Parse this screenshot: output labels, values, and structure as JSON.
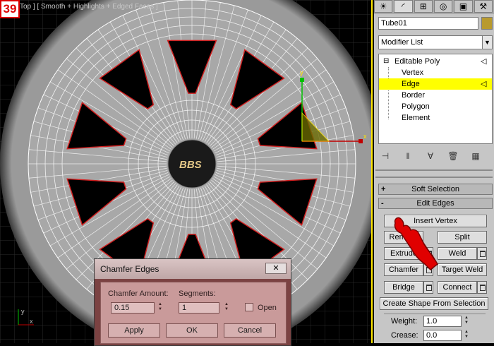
{
  "step_badge": "39",
  "viewport": {
    "label": "Top ] [ Smooth + Highlights + Edged Faces ]",
    "logo_text": "BBS",
    "gizmo_y_label": "y",
    "gizmo_x_label": "x",
    "axis_y_label": "y",
    "axis_x_label": "x"
  },
  "panel": {
    "tabs": [
      "sun-icon",
      "arc-icon",
      "hierarchy-icon",
      "motion-icon",
      "display-icon",
      "utilities-icon"
    ],
    "object_name": "Tube01",
    "object_color": "#b89a2e",
    "modifier_list": "Modifier List",
    "stack": [
      {
        "label": "Editable Poly",
        "level": 0,
        "expander": "⊟"
      },
      {
        "label": "Vertex",
        "level": 1
      },
      {
        "label": "Edge",
        "level": 1,
        "selected": true
      },
      {
        "label": "Border",
        "level": 1
      },
      {
        "label": "Polygon",
        "level": 1
      },
      {
        "label": "Element",
        "level": 1
      }
    ],
    "rollouts": {
      "soft_selection": {
        "sign": "+",
        "label": "Soft Selection"
      },
      "edit_edges": {
        "sign": "-",
        "label": "Edit Edges"
      }
    },
    "buttons": {
      "insert_vertex": "Insert Vertex",
      "remove": "Remove",
      "split": "Split",
      "extrude": "Extrude",
      "weld": "Weld",
      "chamfer": "Chamfer",
      "target_weld": "Target Weld",
      "bridge": "Bridge",
      "connect": "Connect",
      "create_shape": "Create Shape From Selection"
    },
    "weight_label": "Weight:",
    "weight_value": "1.0",
    "crease_label": "Crease:",
    "crease_value": "0.0"
  },
  "dialog": {
    "title": "Chamfer Edges",
    "close": "✕",
    "chamfer_amount_label": "Chamfer Amount:",
    "chamfer_amount_value": "0.15",
    "segments_label": "Segments:",
    "segments_value": "1",
    "open_label": "Open",
    "open_checked": false,
    "apply": "Apply",
    "ok": "OK",
    "cancel": "Cancel"
  }
}
